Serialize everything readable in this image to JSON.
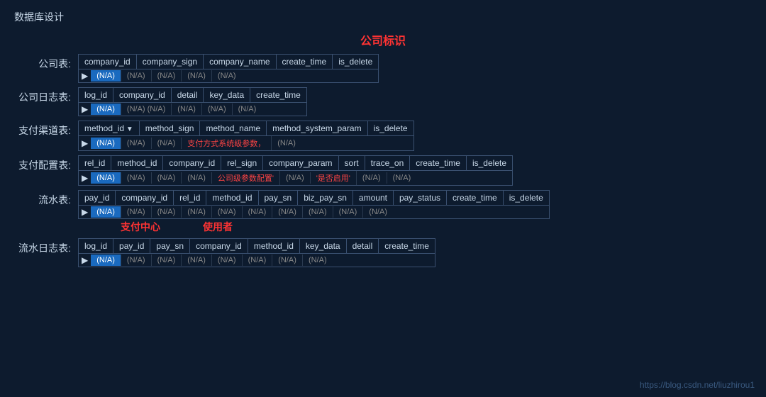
{
  "page_title": "数据库设计",
  "center_label": "公司标识",
  "watermark": "https://blog.csdn.net/liuzhirou1",
  "tables": [
    {
      "label": "公司表:",
      "columns": [
        "company_id",
        "company_sign",
        "company_name",
        "create_time",
        "is_delete"
      ],
      "cells": [
        "(N/A)",
        "(N/A)",
        "(N/A)",
        "(N/A)",
        "(N/A)"
      ],
      "highlighted_col": 0,
      "red_cols": [],
      "annotations": []
    },
    {
      "label": "公司日志表:",
      "columns": [
        "log_id",
        "company_id",
        "detail",
        "key_data",
        "create_time"
      ],
      "cells": [
        "(N/A)",
        "(N/A)",
        "(N/A)",
        "(N/A)",
        "(N/A)"
      ],
      "highlighted_col": 0,
      "red_cols": [],
      "annotations": []
    },
    {
      "label": "支付渠道表:",
      "columns": [
        "method_id",
        "method_sign",
        "method_name",
        "method_system_param",
        "is_delete"
      ],
      "cells": [
        "(N/A)",
        "(N/A)",
        "(N/A)",
        "支付方式系统级参数，",
        "(N/A)"
      ],
      "highlighted_col": 0,
      "arrow_col": 0,
      "red_cols": [
        3
      ],
      "annotations": []
    },
    {
      "label": "支付配置表:",
      "columns": [
        "rel_id",
        "method_id",
        "company_id",
        "rel_sign",
        "company_param",
        "sort",
        "trace_on",
        "create_time",
        "is_delete"
      ],
      "cells": [
        "(N/A)",
        "(N/A)",
        "(N/A)",
        "(N/A)",
        "公司级参数配置'",
        "(N/A)",
        "'是否启用'",
        "(N/A)",
        "(N/A)"
      ],
      "highlighted_col": 0,
      "red_cols": [
        4,
        6
      ],
      "annotations": []
    },
    {
      "label": "流水表:",
      "columns": [
        "pay_id",
        "company_id",
        "rel_id",
        "method_id",
        "pay_sn",
        "biz_pay_sn",
        "amount",
        "pay_status",
        "create_time",
        "is_delete"
      ],
      "cells": [
        "(N/A)",
        "(N/A)",
        "(N/A)",
        "(N/A)",
        "(N/A)",
        "(N/A)",
        "(N/A)",
        "(N/A)",
        "(N/A)",
        "(N/A)"
      ],
      "highlighted_col": 0,
      "red_cols": [],
      "annotation_pay": "支付中心",
      "annotation_user": "使用者"
    },
    {
      "label": "流水日志表:",
      "columns": [
        "log_id",
        "pay_id",
        "pay_sn",
        "company_id",
        "method_id",
        "key_data",
        "detail",
        "create_time"
      ],
      "cells": [
        "(N/A)",
        "(N/A)",
        "(N/A)",
        "(N/A)",
        "(N/A)",
        "(N/A)",
        "(N/A)",
        "(N/A)"
      ],
      "highlighted_col": 0,
      "red_cols": [],
      "annotations": []
    }
  ]
}
